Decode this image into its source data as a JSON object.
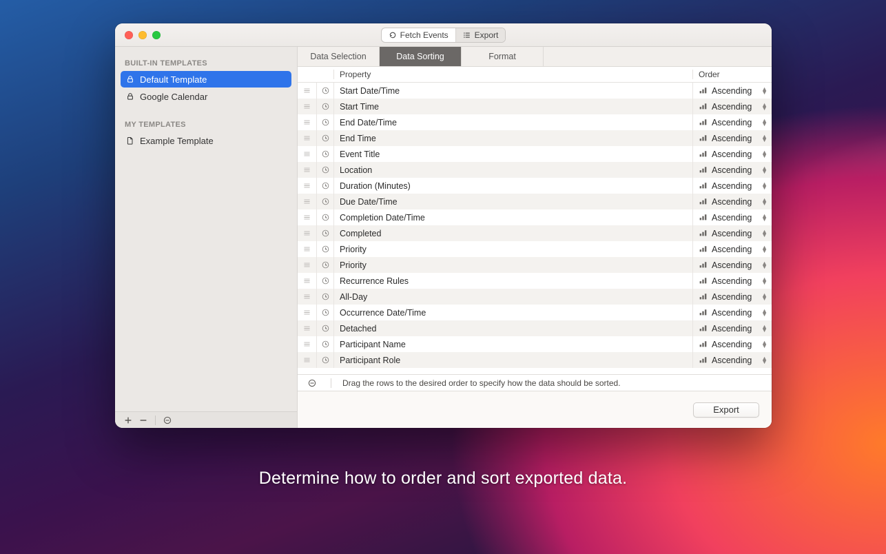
{
  "caption": "Determine how to order and sort exported data.",
  "toolbar": {
    "fetch_label": "Fetch Events",
    "export_label": "Export"
  },
  "sidebar": {
    "groups": [
      {
        "title": "BUILT-IN TEMPLATES",
        "items": [
          {
            "label": "Default Template",
            "icon": "lock",
            "selected": true
          },
          {
            "label": "Google Calendar",
            "icon": "lock",
            "selected": false
          }
        ]
      },
      {
        "title": "MY TEMPLATES",
        "items": [
          {
            "label": "Example Template",
            "icon": "doc",
            "selected": false
          }
        ]
      }
    ]
  },
  "tabs": [
    {
      "label": "Data Selection",
      "active": false
    },
    {
      "label": "Data Sorting",
      "active": true
    },
    {
      "label": "Format",
      "active": false
    }
  ],
  "table": {
    "header_property": "Property",
    "header_order": "Order",
    "order_label": "Ascending",
    "rows": [
      {
        "property": "Start Date/Time"
      },
      {
        "property": "Start Time"
      },
      {
        "property": "End Date/Time"
      },
      {
        "property": "End Time"
      },
      {
        "property": "Event Title"
      },
      {
        "property": "Location"
      },
      {
        "property": "Duration (Minutes)"
      },
      {
        "property": "Due Date/Time"
      },
      {
        "property": "Completion Date/Time"
      },
      {
        "property": "Completed"
      },
      {
        "property": "Priority"
      },
      {
        "property": "Priority"
      },
      {
        "property": "Recurrence Rules"
      },
      {
        "property": "All-Day"
      },
      {
        "property": "Occurrence Date/Time"
      },
      {
        "property": "Detached"
      },
      {
        "property": "Participant Name"
      },
      {
        "property": "Participant Role"
      }
    ],
    "hint": "Drag the rows to the desired order to specify how the data should be sorted."
  },
  "footer": {
    "export_button": "Export"
  }
}
